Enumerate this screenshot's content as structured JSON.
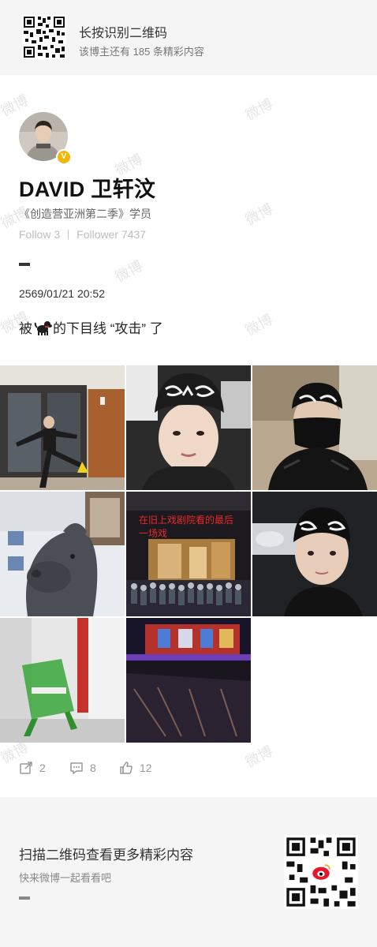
{
  "top_banner": {
    "title": "长按识别二维码",
    "subtitle": "该博主还有 185 条精彩内容"
  },
  "profile": {
    "name": "DAVID 卫轩汶",
    "description": "《创造营亚洲第二季》学员",
    "following": "Follow 3",
    "followers": "Follower 7437",
    "verified_color": "#f2b705"
  },
  "post": {
    "timestamp": "2569/01/21 20:52",
    "text_before": "被",
    "text_after": "的下目线 “攻击” 了",
    "emoji_icon": "dog-icon",
    "photo_caption": "在旧上戏剧院看的最后一场戏"
  },
  "actions": {
    "repost_count": "2",
    "comment_count": "8",
    "like_count": "12"
  },
  "bottom_banner": {
    "title": "扫描二维码查看更多精彩内容",
    "subtitle": "快来微博一起看看吧"
  },
  "watermark_text": "微博"
}
